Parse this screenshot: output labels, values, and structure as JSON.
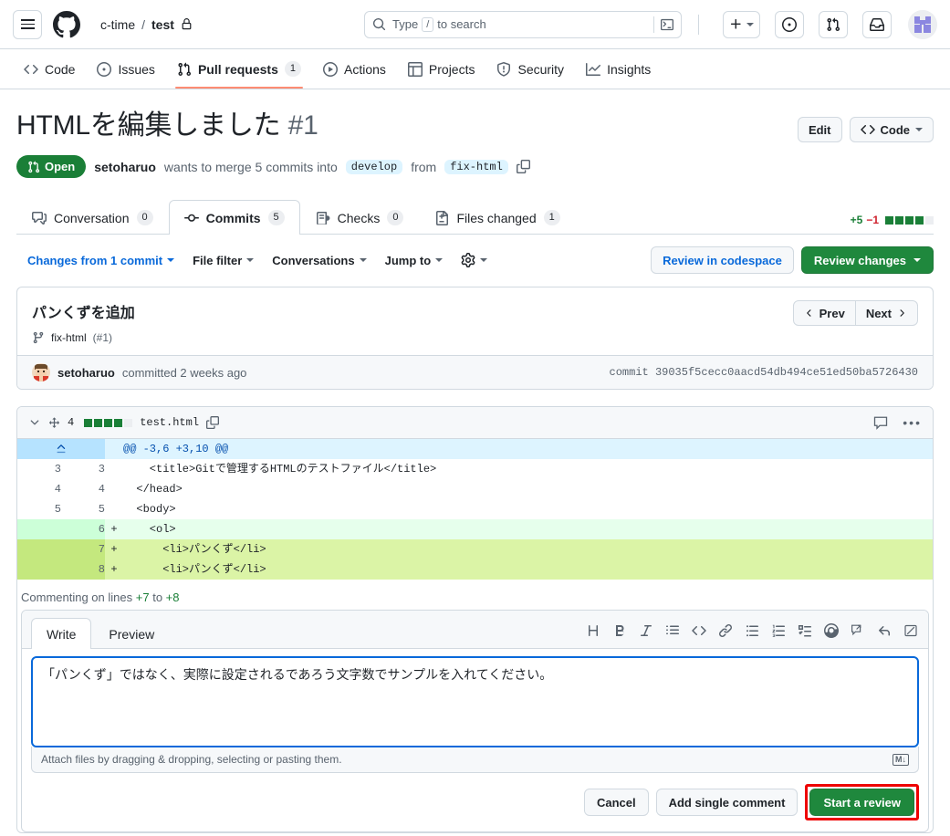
{
  "appbar": {
    "menu_icon": "hamburger-icon",
    "logo_icon": "github-logo-icon",
    "owner": "c-time",
    "separator": "/",
    "repo": "test",
    "private_icon": "lock-icon",
    "search": {
      "icon": "search-icon",
      "prefix": "Type",
      "key": "/",
      "suffix": "to search",
      "terminal_icon": "terminal-icon"
    },
    "create_icon": "plus-icon",
    "issues_icon": "issue-opened-icon",
    "pulls_icon": "git-pull-request-icon",
    "inbox_icon": "inbox-icon",
    "avatar_name": "user-avatar"
  },
  "reponav": [
    {
      "label": "Code",
      "icon": "code-icon",
      "count": null,
      "active": false
    },
    {
      "label": "Issues",
      "icon": "issue-opened-icon",
      "count": null,
      "active": false
    },
    {
      "label": "Pull requests",
      "icon": "git-pull-request-icon",
      "count": "1",
      "active": true
    },
    {
      "label": "Actions",
      "icon": "play-icon",
      "count": null,
      "active": false
    },
    {
      "label": "Projects",
      "icon": "table-icon",
      "count": null,
      "active": false
    },
    {
      "label": "Security",
      "icon": "shield-icon",
      "count": null,
      "active": false
    },
    {
      "label": "Insights",
      "icon": "graph-icon",
      "count": null,
      "active": false
    }
  ],
  "pr": {
    "title": "HTMLを編集しました",
    "number": "#1",
    "edit_label": "Edit",
    "code_label": "Code",
    "state": "Open",
    "state_icon": "git-pull-request-icon",
    "author": "setoharuo",
    "action_text": "wants to merge 5 commits into",
    "base_branch": "develop",
    "from_text": "from",
    "head_branch": "fix-html",
    "copy_icon": "copy-icon"
  },
  "prtabs": [
    {
      "label": "Conversation",
      "count": "0",
      "icon": "comment-discussion-icon",
      "selected": false
    },
    {
      "label": "Commits",
      "count": "5",
      "icon": "git-commit-icon",
      "selected": true
    },
    {
      "label": "Checks",
      "count": "0",
      "icon": "checklist-icon",
      "selected": false
    },
    {
      "label": "Files changed",
      "count": "1",
      "icon": "file-diff-icon",
      "selected": false
    }
  ],
  "diffstat": {
    "additions": "+5",
    "deletions": "−1",
    "blocks": [
      "g",
      "g",
      "g",
      "g",
      "n"
    ]
  },
  "filters": {
    "changes_from": "Changes from 1 commit",
    "file_filter": "File filter",
    "conversations": "Conversations",
    "jump_to": "Jump to",
    "settings_icon": "gear-icon",
    "review_codespace": "Review in codespace",
    "review_changes": "Review changes"
  },
  "commit": {
    "message": "パンくずを追加",
    "branch_icon": "git-branch-icon",
    "branch": "fix-html",
    "branch_pr": "(#1)",
    "prev_label": "Prev",
    "next_label": "Next",
    "author": "setoharuo",
    "committed_text": "committed 2 weeks ago",
    "sha_label": "commit",
    "sha": "39035f5cecc0aacd54db494ce51ed50ba5726430"
  },
  "file": {
    "chevron_icon": "chevron-down-icon",
    "diff_icon": "diff-stat-icon",
    "changes": "4",
    "blocks": [
      "g",
      "g",
      "g",
      "g",
      "n"
    ],
    "name": "test.html",
    "copy_icon": "copy-icon",
    "comment_icon": "comment-icon",
    "kebab_icon": "kebab-horizontal-icon",
    "hunk": "@@ -3,6 +3,10 @@",
    "expand_icon": "expand-up-icon",
    "rows": [
      {
        "type": "ctx",
        "old": "3",
        "new": "3",
        "sign": "",
        "code": "    <title>Gitで管理するHTMLのテストファイル</title>"
      },
      {
        "type": "ctx",
        "old": "4",
        "new": "4",
        "sign": "",
        "code": "  </head>"
      },
      {
        "type": "ctx",
        "old": "5",
        "new": "5",
        "sign": "",
        "code": "  <body>"
      },
      {
        "type": "add",
        "old": "",
        "new": "6",
        "sign": "+",
        "code": "    <ol>"
      },
      {
        "type": "add-sel",
        "old": "",
        "new": "7",
        "sign": "+",
        "code": "      <li>パンくず</li>"
      },
      {
        "type": "add-sel",
        "old": "",
        "new": "8",
        "sign": "+",
        "code": "      <li>パンくず</li>"
      }
    ]
  },
  "comment_form": {
    "commenting_prefix": "Commenting on lines",
    "line_start": "+7",
    "to_text": "to",
    "line_end": "+8",
    "tab_write": "Write",
    "tab_preview": "Preview",
    "toolbar_icons": [
      "heading-icon",
      "bold-icon",
      "italic-icon",
      "quote-icon",
      "code-icon",
      "link-icon",
      "unordered-list-icon",
      "ordered-list-icon",
      "task-list-icon",
      "mention-icon",
      "reference-icon",
      "reply-icon",
      "saved-replies-icon"
    ],
    "body": "「パンくず」ではなく、実際に設定されるであろう文字数でサンプルを入れてください。",
    "attach_text": "Attach files by dragging & dropping, selecting or pasting them.",
    "markdown_badge": "M↓",
    "cancel_label": "Cancel",
    "add_single_label": "Add single comment",
    "start_review_label": "Start a review"
  },
  "colors": {
    "accent_blue": "#0969da",
    "green": "#1f883d",
    "open_green": "#1a7f37",
    "red_highlight": "#ee0000",
    "border": "#d1d9e0",
    "tab_underline": "#fd8c73"
  }
}
